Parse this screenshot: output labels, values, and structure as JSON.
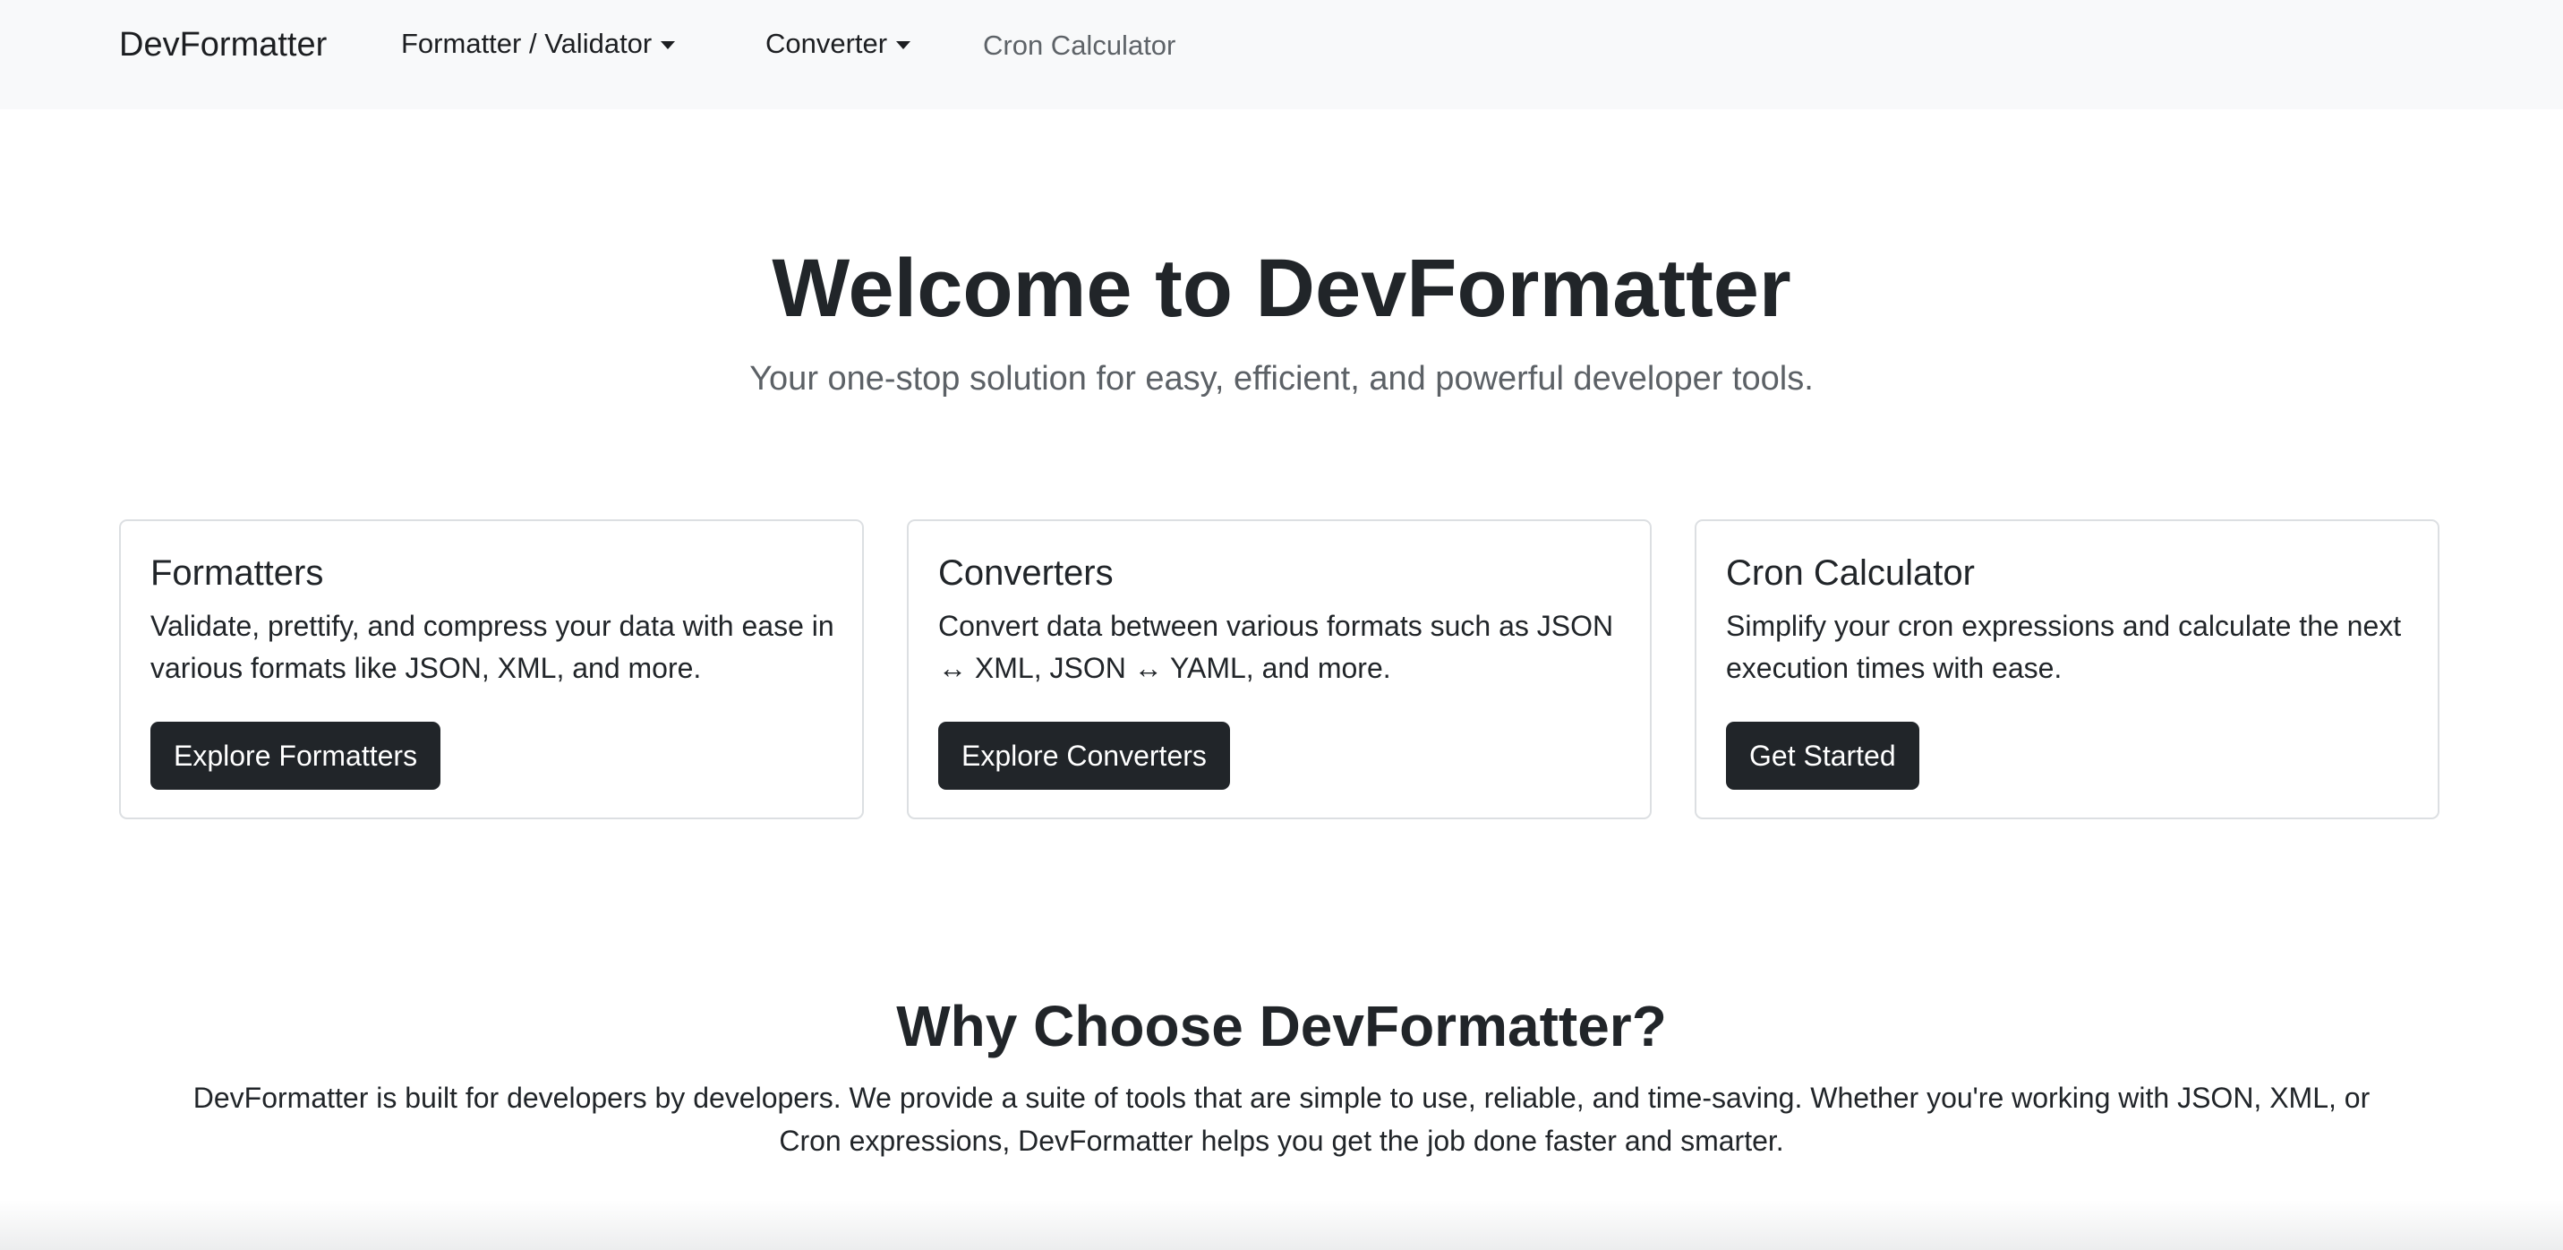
{
  "navbar": {
    "brand": "DevFormatter",
    "items": [
      {
        "label": "Formatter / Validator",
        "dropdown": true
      },
      {
        "label": "Converter",
        "dropdown": true
      },
      {
        "label": "Cron Calculator",
        "dropdown": false
      }
    ]
  },
  "hero": {
    "title": "Welcome to DevFormatter",
    "subtitle": "Your one-stop solution for easy, efficient, and powerful developer tools."
  },
  "cards": [
    {
      "title": "Formatters",
      "text": "Validate, prettify, and compress your data with ease in various formats like JSON, XML, and more.",
      "button": "Explore Formatters"
    },
    {
      "title": "Converters",
      "text": "Convert data between various formats such as JSON ↔ XML, JSON ↔ YAML, and more.",
      "button": "Explore Converters"
    },
    {
      "title": "Cron Calculator",
      "text": "Simplify your cron expressions and calculate the next execution times with ease.",
      "button": "Get Started"
    }
  ],
  "why": {
    "title": "Why Choose DevFormatter?",
    "text": "DevFormatter is built for developers by developers. We provide a suite of tools that are simple to use, reliable, and time-saving. Whether you're working with JSON, XML, or Cron expressions, DevFormatter helps you get the job done faster and smarter."
  },
  "colors": {
    "navbar_bg": "#f8f9fa",
    "button_bg": "#212529",
    "text": "#212529",
    "muted": "#5c6166"
  }
}
